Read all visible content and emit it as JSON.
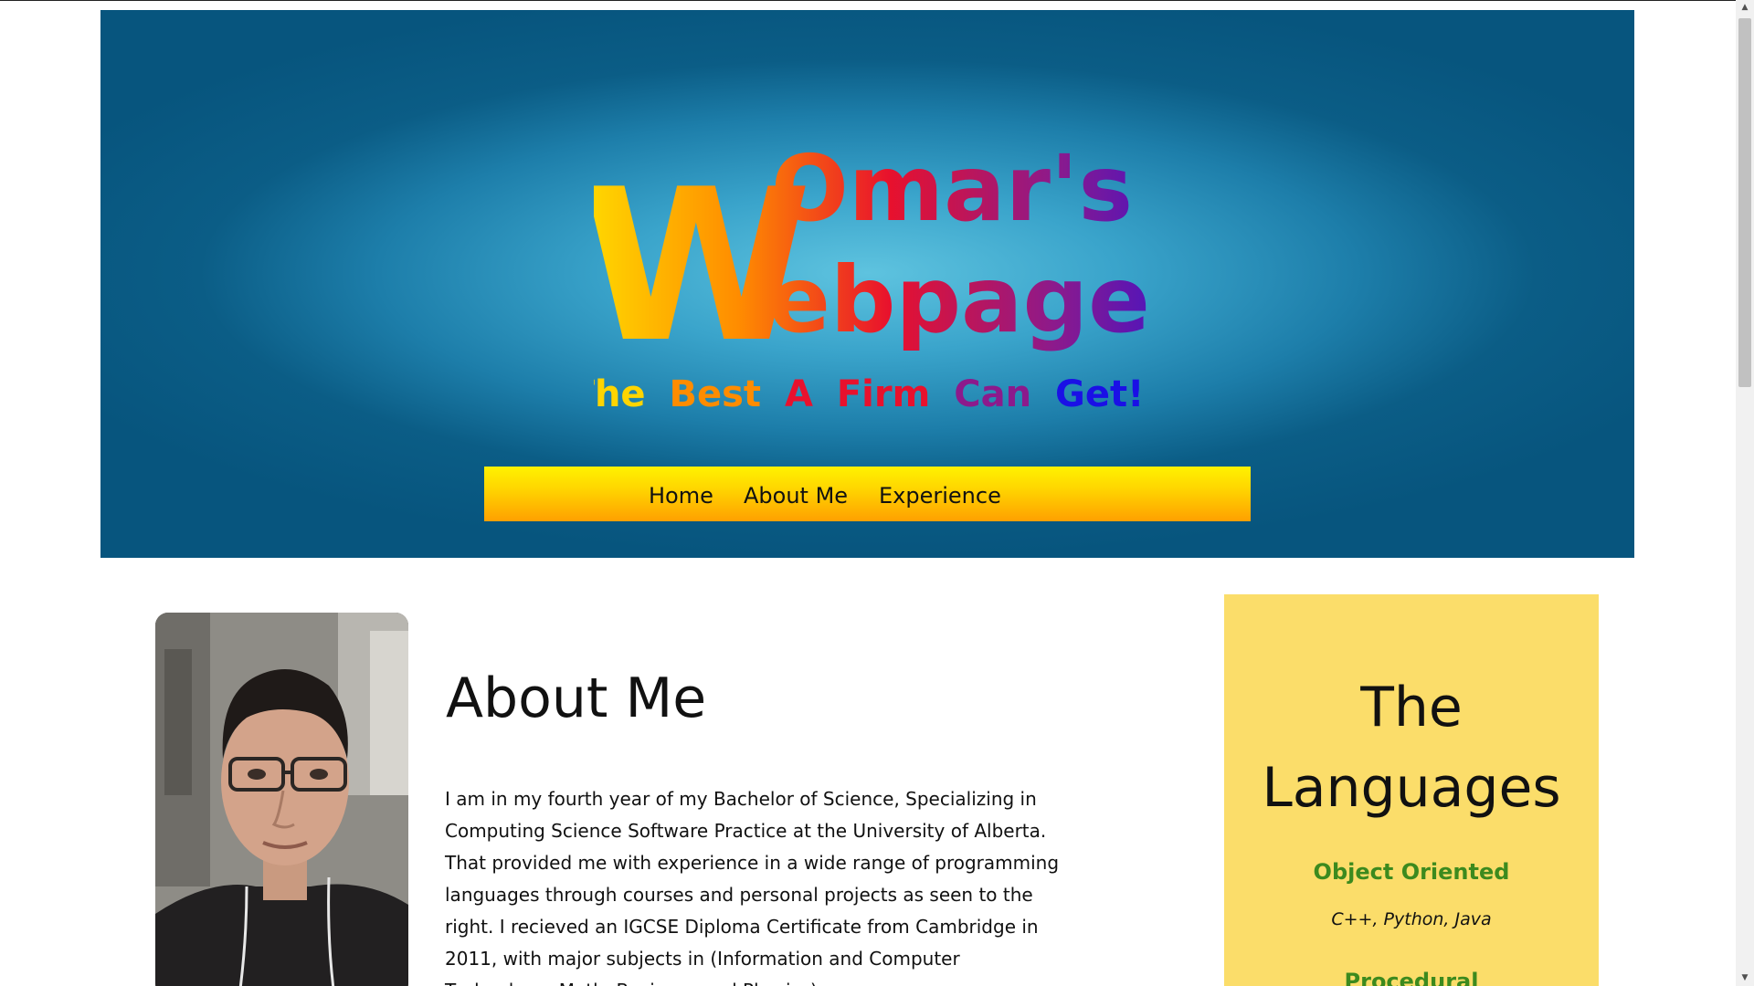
{
  "colors": {
    "logo_gradient": [
      "#ffd500",
      "#ff8c00",
      "#e8112d",
      "#8c1a8c",
      "#1a10e6"
    ],
    "nav_gradient": [
      "#fff200",
      "#ffa000"
    ],
    "banner_center": "#5ec3df",
    "banner_edge": "#07557e",
    "lang_panel_bg": "#fbdd6a",
    "lang_category_color": "#3c8a1e"
  },
  "logo": {
    "big_letter": "W",
    "line1": "Omar's",
    "line2": "ebpage",
    "tagline_words": [
      "The",
      "Best",
      "A",
      "Firm",
      "Can",
      "Get!"
    ]
  },
  "nav": {
    "items": [
      {
        "label": "Home"
      },
      {
        "label": "About Me"
      },
      {
        "label": "Experience"
      }
    ]
  },
  "profile": {
    "photo_icon": "person-photo"
  },
  "about": {
    "heading": "About Me",
    "body": "I am in my fourth year of my Bachelor of Science, Specializing in Computing Science Software Practice at the University of Alberta. That provided me with experience in a wide range of programming languages through courses and personal projects as seen to the right. I recieved an IGCSE Diploma Certificate from Cambridge in 2011, with major subjects in (Information and Computer Technology, Math, Business and Physics)."
  },
  "languages": {
    "title": "The Languages",
    "categories": [
      {
        "name": "Object Oriented",
        "items": "C++, Python, Java"
      },
      {
        "name": "Procedural",
        "items": ""
      }
    ]
  },
  "scrollbar": {
    "up_icon": "arrow-up-icon",
    "down_icon": "arrow-down-icon"
  }
}
